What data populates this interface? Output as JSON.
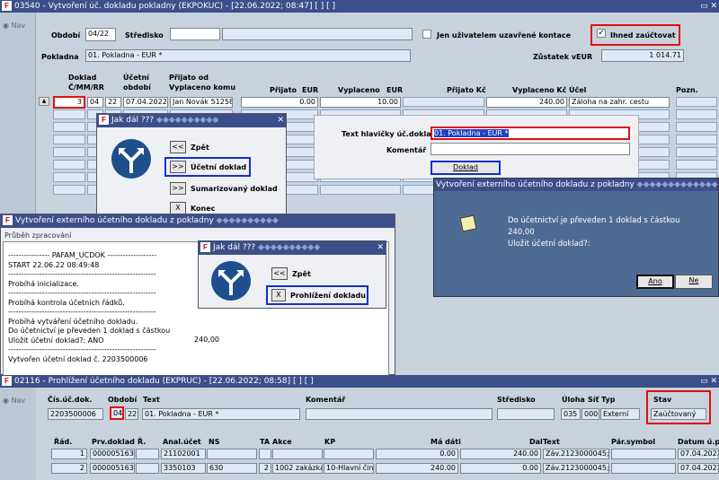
{
  "main_window": {
    "title": "03540 - Vytvoření úč. dokladu pokladny (EKPOKUC) - [22.06.2022; 08:47]  [ ]  [ ]",
    "nav": "Nav",
    "obdobi_label": "Období",
    "obdobi": "04/22",
    "stredisko_label": "Středisko",
    "only_closed_label": "Jen uživatelem uzavřené kontace",
    "immediate_label": "Ihned zaúčtovat",
    "immediate_check": "✓",
    "pokladna_label": "Pokladna",
    "pokladna": "01. Pokladna - EUR *",
    "zustatek_label": "Zůstatek v",
    "zustatek_cur": "EUR",
    "zustatek": "1 014.71",
    "cols": {
      "doklad": "Doklad",
      "cmmrr": "Č/MM/RR",
      "ucetni": "Účetní",
      "obdobi": "období",
      "prijato_od": "Přijato od",
      "vyplaceno_komu": "Vyplaceno komu",
      "prijato": "Přijato",
      "eur1": "EUR",
      "vyplaceno": "Vyplaceno",
      "eur2": "EUR",
      "prijato_kc": "Přijato Kč",
      "vyplaceno_kc": "Vyplaceno Kč",
      "ucel": "Účel",
      "pozn": "Pozn."
    },
    "row": {
      "c": "3",
      "mm": "04",
      "rr": "22",
      "obdobi": "07.04.2022",
      "osoba": "Jan Novák 51258",
      "prijato": "0.00",
      "vyplaceno": "10.00",
      "vyplaceno_kc": "240.00",
      "ucel": "Záloha na zahr. cestu"
    },
    "text_hlav_label": "Text hlavičky úč.dokladu",
    "text_hlav": "01. Pokladna - EUR *",
    "komentar_label": "Komentář",
    "doklad_btn": "Doklad"
  },
  "jak_dal_1": {
    "title": "Jak dál ???",
    "zpet": "Zpět",
    "zpet_btn": "<<",
    "ucetni": "Účetní doklad",
    "ucetni_btn": ">>",
    "sum": "Sumarizovaný doklad",
    "sum_btn": ">>",
    "konec": "Konec",
    "konec_btn": "X"
  },
  "confirm": {
    "title": "Vytvoření externího účetního dokladu z pokladny",
    "line1": "Do účetnictví  je převeden 1 doklad s částkou",
    "line2": "240,00",
    "line3": " Uložit účetní doklad?:",
    "ano": "Ano",
    "ne": "Ne"
  },
  "progress": {
    "title": "Vytvoření externího účetního dokladu z pokladny",
    "label": "Průběh zpracování",
    "lines": [
      "---------------- PAFAM_UCDOK -------------------",
      "START 22.06.22 08:49:48",
      "---------------------------------------------------------",
      "Probíhá inicializace.",
      "---------------------------------------------------------",
      "Probíhá kontrola účetních řádků.",
      "---------------------------------------------------------",
      "Probíhá vytváření účetního dokladu.",
      "Do účetnictví  je převeden 1 doklad s částkou",
      "Uložit účetní doklad?: ANO",
      "---------------------------------------------------------",
      "Vytvořen účetní doklad č. 2203500006"
    ],
    "amount": "240,00"
  },
  "jak_dal_2": {
    "title": "Jak dál ???",
    "zpet": "Zpět",
    "zpet_btn": "<<",
    "prohl": "Prohlížení dokladu",
    "prohl_btn": "X"
  },
  "review": {
    "title": "02116 - Prohlížení účetního dokladu (EKPRUC) - [22.06.2022; 08:58]  [ ]  [ ]",
    "nav": "Nav",
    "h": {
      "cis": "Čís.úč.dok.",
      "obdobi": "Období",
      "text": "Text",
      "komentar": "Komentář",
      "stredisko": "Středisko",
      "uloha": "Úloha",
      "sit": "Síť",
      "typ": "Typ",
      "stav": "Stav"
    },
    "v": {
      "cis": "2203500006",
      "mm": "04",
      "rr": "22",
      "text": "01. Pokladna - EUR *",
      "uloha": "035",
      "sit": "000",
      "typ": "Externí",
      "stav": "Zaúčtovaný"
    },
    "cols": {
      "rad": "Řád.",
      "prv": "Prv.doklad",
      "r": "Ř.",
      "anal": "Anal.účet",
      "ns": "NS",
      "ta": "TA",
      "akce": "Akce",
      "kp": "KP",
      "ma_dati": "Má dáti",
      "dal": "Dal",
      "text": "Text",
      "par": "Pár.symbol",
      "datum": "Datum ú.p"
    },
    "rows": [
      {
        "rad": "1",
        "prv": "000005163€",
        "r": "",
        "anal": "21102001",
        "ns": "",
        "ta": "",
        "akce": "",
        "kp": "",
        "ma": "0.00",
        "dal": "240.00",
        "text": "Záv.2123000045;",
        "datum": "07.04.2022"
      },
      {
        "rad": "2",
        "prv": "000005163€",
        "r": "",
        "anal": "3350103",
        "ns": "630",
        "ta": "2",
        "akce": "1002 zakázka",
        "kp": "10-Hlavní činn",
        "ma": "240.00",
        "dal": "0.00",
        "text": "Záv.2123000045;",
        "datum": "07.04.2022"
      }
    ]
  }
}
